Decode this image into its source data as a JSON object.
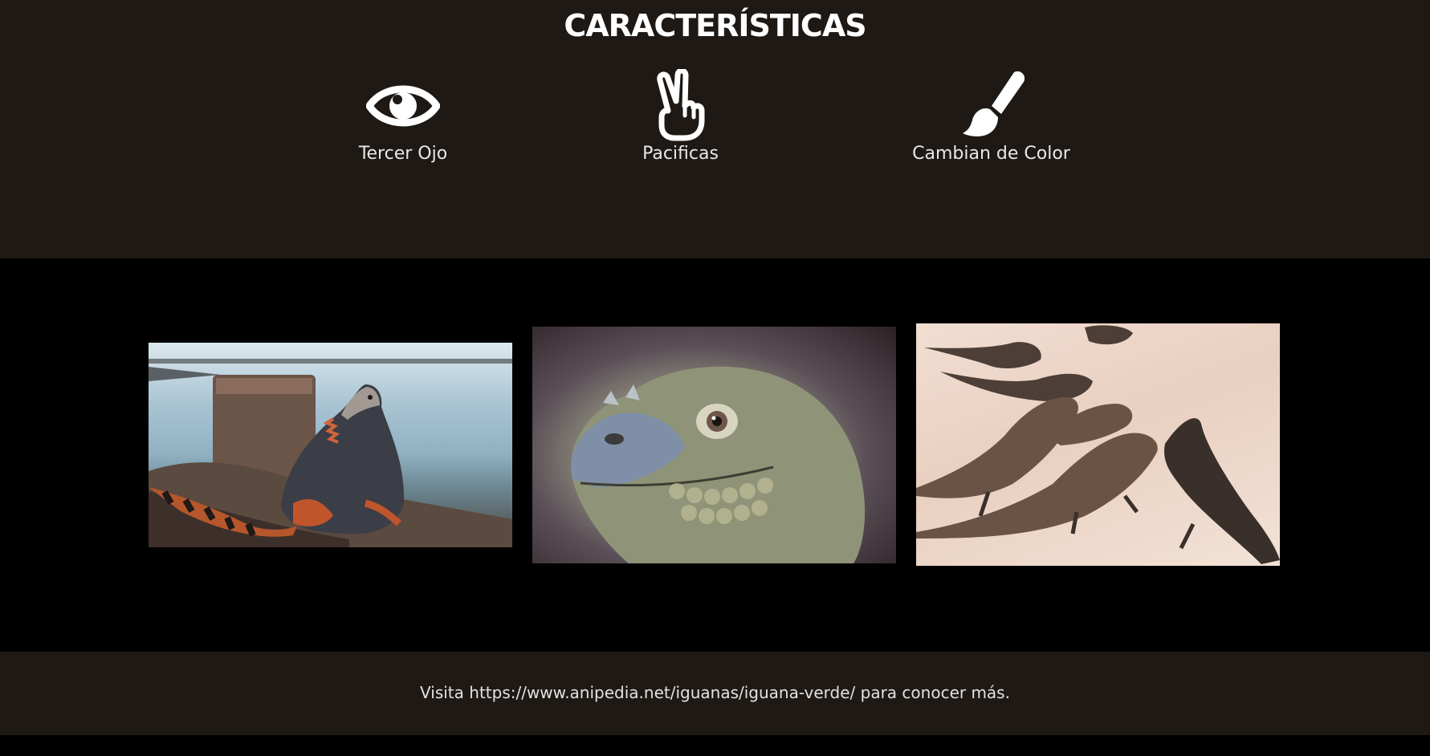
{
  "features": {
    "title": "CARACTERÍSTICAS",
    "items": [
      {
        "icon": "eye-icon",
        "label": "Tercer Ojo"
      },
      {
        "icon": "peace-hand-icon",
        "label": "Pacificas"
      },
      {
        "icon": "paintbrush-icon",
        "label": "Cambian de Color"
      }
    ]
  },
  "gallery": {
    "images": [
      {
        "name": "iguana-on-shore-photo"
      },
      {
        "name": "iguana-closeup-photo"
      },
      {
        "name": "iguanas-on-sand-photo"
      }
    ]
  },
  "footer": {
    "text": "Visita https://www.anipedia.net/iguanas/iguana-verde/ para conocer más."
  },
  "colors": {
    "section_bg": "#1e1914",
    "gallery_bg": "#000000",
    "text": "#ffffff"
  }
}
